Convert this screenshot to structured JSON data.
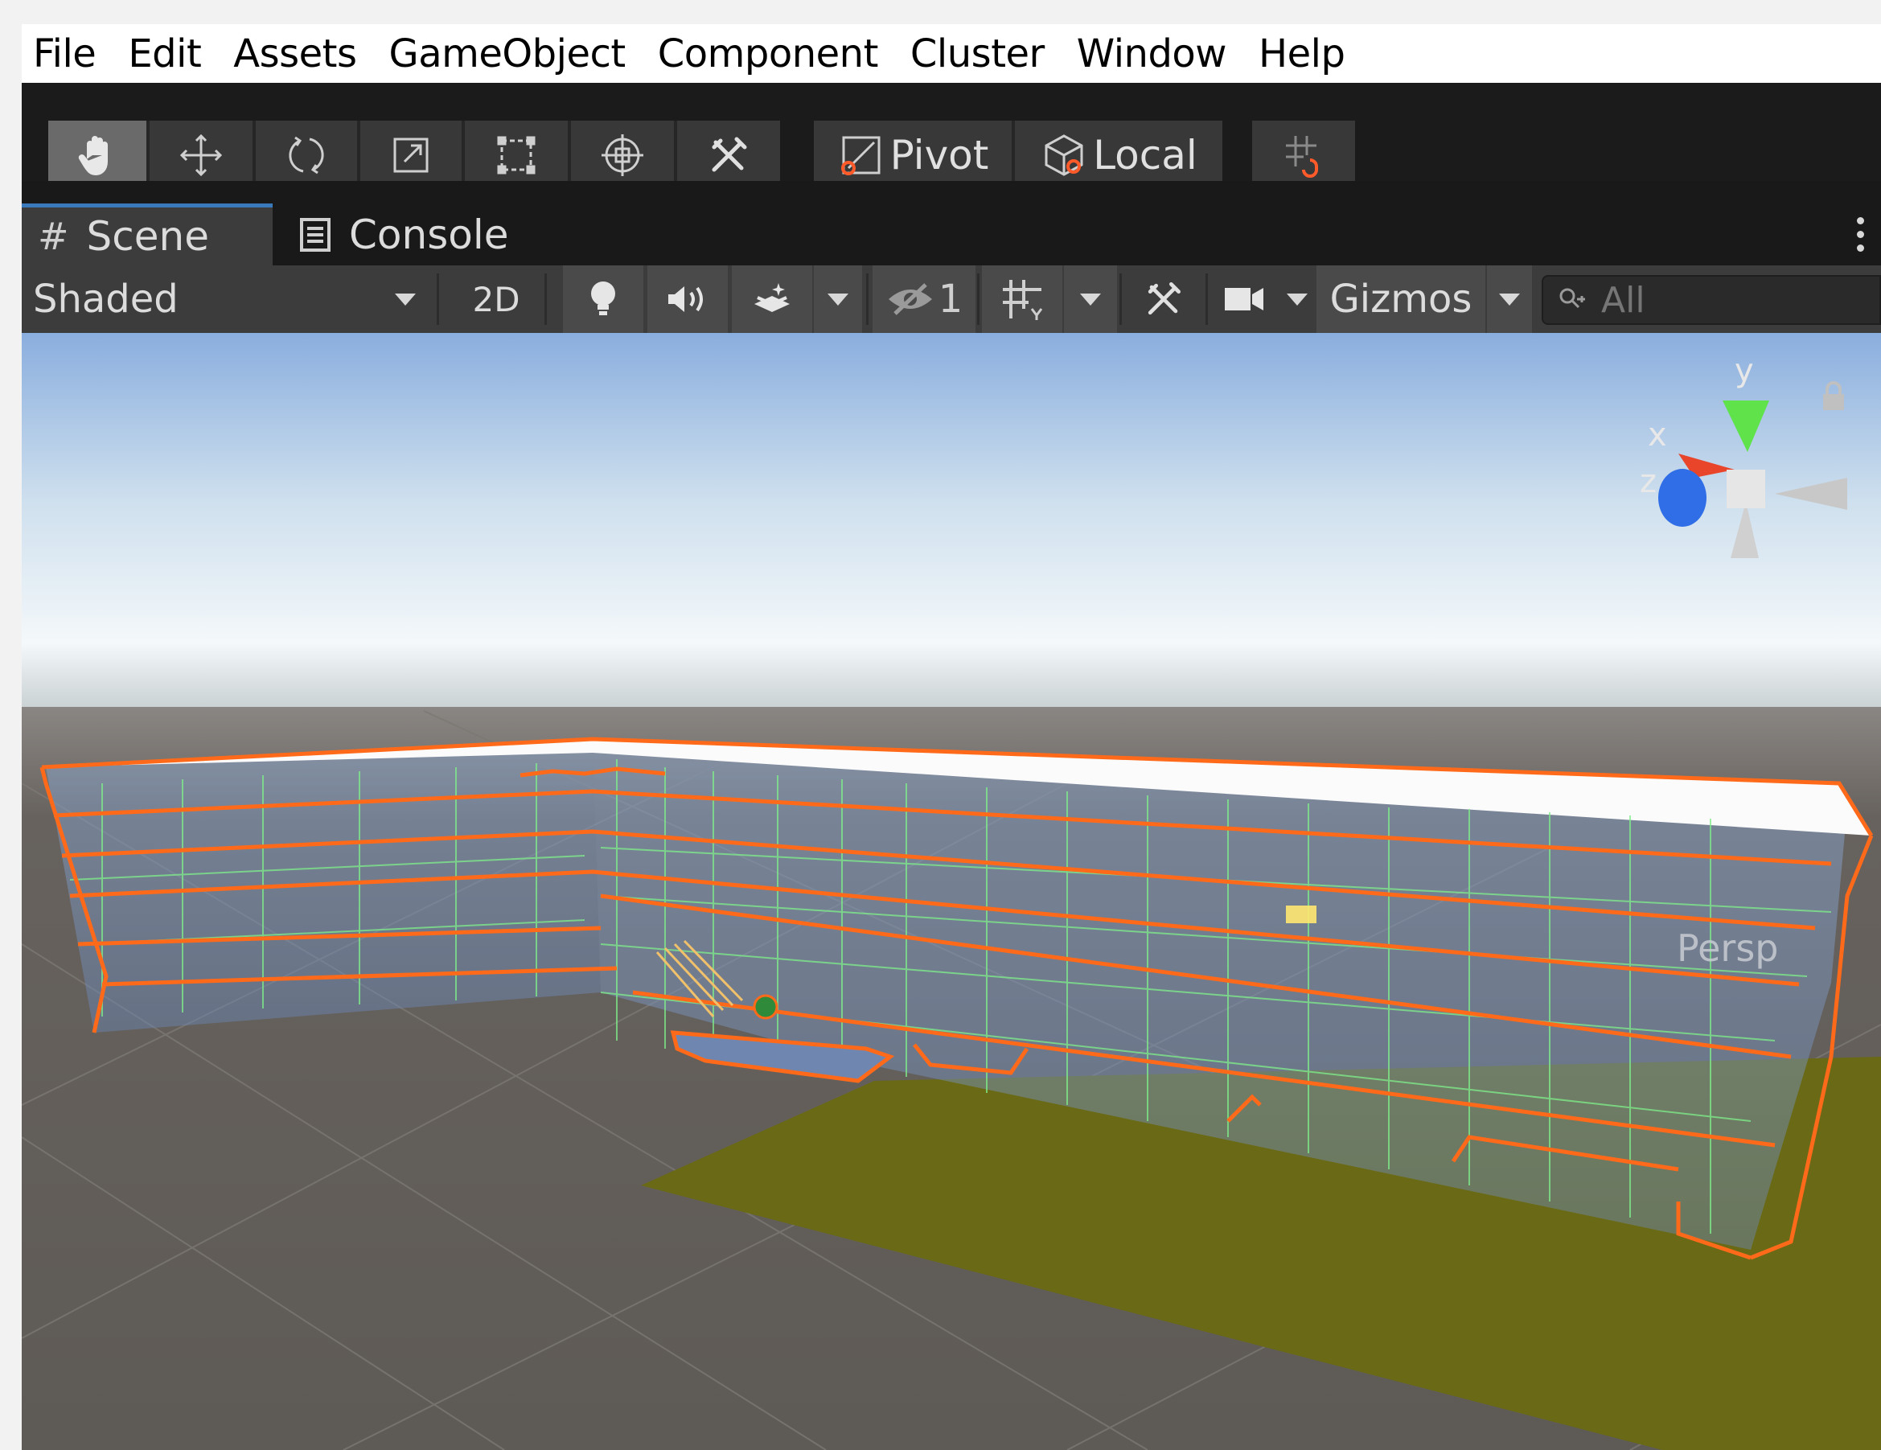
{
  "menu": [
    "File",
    "Edit",
    "Assets",
    "GameObject",
    "Component",
    "Cluster",
    "Window",
    "Help"
  ],
  "toolbar": {
    "tools": [
      {
        "icon": "hand-icon",
        "active": true
      },
      {
        "icon": "move-icon",
        "active": false
      },
      {
        "icon": "rotate-icon",
        "active": false
      },
      {
        "icon": "scale-icon",
        "active": false
      },
      {
        "icon": "rect-transform-icon",
        "active": false
      },
      {
        "icon": "transform-icon",
        "active": false
      },
      {
        "icon": "custom-tools-icon",
        "active": false
      }
    ],
    "pivot_label": "Pivot",
    "local_label": "Local",
    "snap_icon": "grid-snap-icon"
  },
  "tabs": [
    {
      "label": "Scene",
      "icon": "#",
      "active": true
    },
    {
      "label": "Console",
      "icon": "console-icon",
      "active": false
    }
  ],
  "scene_toolbar": {
    "draw_mode": "Shaded",
    "mode_2d": "2D",
    "hidden_count": "1",
    "gizmos_label": "Gizmos",
    "search_placeholder": "All"
  },
  "viewport": {
    "projection_label": "Persp",
    "axes": {
      "x": "x",
      "y": "y",
      "z": "z"
    },
    "colors": {
      "sky_top": "#8aaede",
      "horizon": "#f4f8fa",
      "ground": "#5e5a56",
      "grass": "#6a6a16",
      "selection_outline": "#ff6a1a",
      "wireframe": "#7fef8a"
    }
  }
}
